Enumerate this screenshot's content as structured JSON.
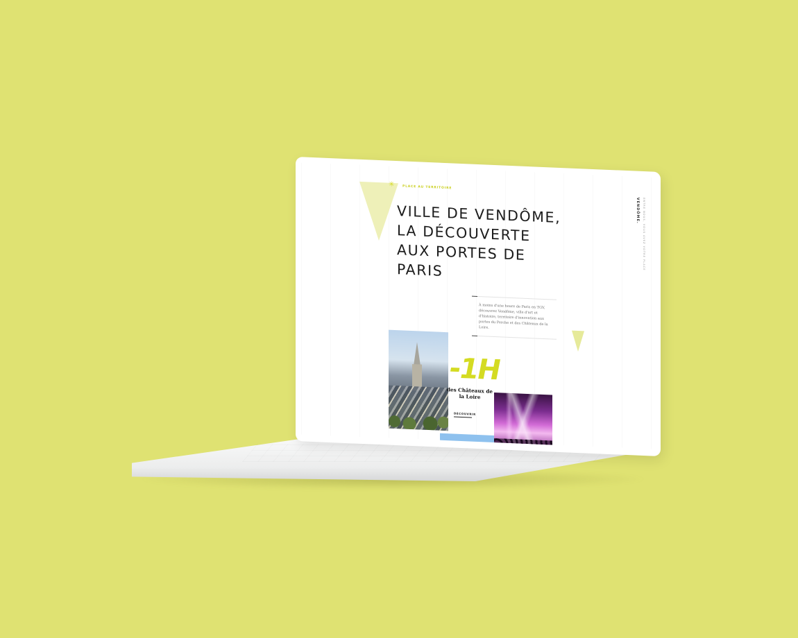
{
  "page": {
    "background_color": "#dfe272",
    "accent_color": "#d4db22",
    "blue_accent": "#8ec1ee"
  },
  "site": {
    "eyebrow": "PLACE AU TERRITOIRE",
    "brand": "VENDÔME.",
    "brand_tagline": "ENTRE NOUS, VOUS AVEZ VOTRE PLACE",
    "hero_title": "Ville de Vendôme, la découverte aux portes de Paris",
    "intro": "À moins d'une heure de Paris en TGV, découvrez Vendôme, ville d'art et d'histoire, territoire d'innovation aux portes du Perche et des Châteaux de la Loire.",
    "stat": {
      "value": "-1H",
      "label": "des Châteaux de la Loire"
    },
    "discover_label": "DÉCOUVRIR"
  },
  "icons": {
    "eyebrow_icon": "star-icon"
  }
}
